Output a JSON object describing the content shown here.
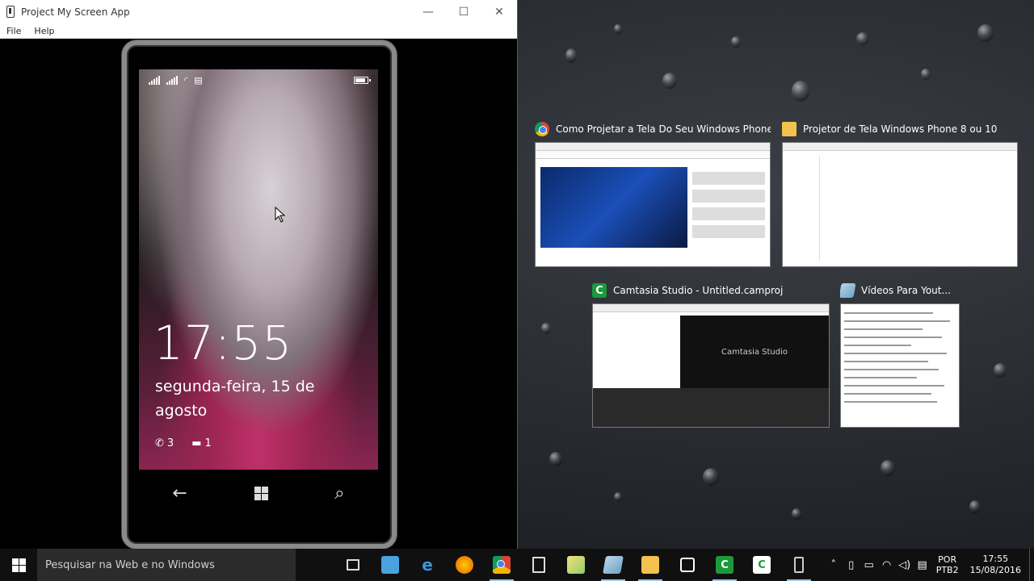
{
  "app_window": {
    "title": "Project My Screen App",
    "menu": [
      "File",
      "Help"
    ],
    "controls": {
      "minimize": "—",
      "maximize": "☐",
      "close": "✕"
    }
  },
  "phone": {
    "lock_time": "17:55",
    "lock_date": "segunda-feira, 15 de agosto",
    "missed_calls": "3",
    "messages": "1",
    "nav": {
      "back": "←",
      "search": "⌕"
    }
  },
  "task_view": [
    {
      "title": "Como Projetar a Tela Do Seu Windows Phone...",
      "icon": "chrome-icon"
    },
    {
      "title": "Projetor de Tela Windows Phone 8 ou 10",
      "icon": "folder-icon"
    },
    {
      "title": "Camtasia Studio - Untitled.camproj",
      "icon": "camtasia-icon",
      "inner_text": "Camtasia Studio"
    },
    {
      "title": "Vídeos Para Yout...",
      "icon": "notepad-icon"
    }
  ],
  "taskbar": {
    "search_placeholder": "Pesquisar na Web e no Windows",
    "icons": [
      "task-view-icon",
      "desktop-icon",
      "edge-icon",
      "firefox-icon",
      "chrome-icon",
      "calculator-icon",
      "files-icon",
      "notepad-icon",
      "explorer-icon",
      "store-icon",
      "camtasia-icon",
      "camtasia-recorder-icon",
      "phone-icon"
    ],
    "lang_1": "POR",
    "lang_2": "PTB2",
    "time": "17:55",
    "date": "15/08/2016"
  }
}
